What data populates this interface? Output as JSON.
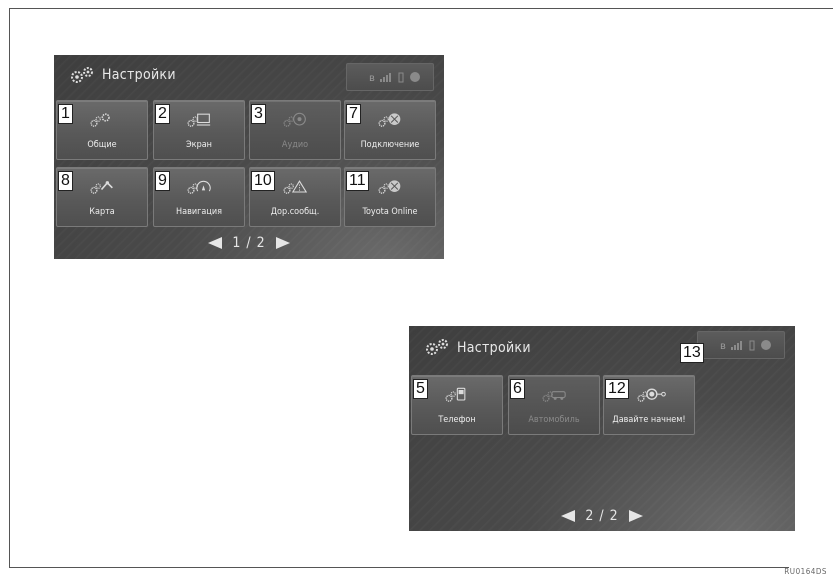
{
  "screen1": {
    "title": "Настройки",
    "buttons": [
      {
        "num": "1",
        "label": "Общие",
        "icon": "gears-icon",
        "enabled": true
      },
      {
        "num": "2",
        "label": "Экран",
        "icon": "display-icon",
        "enabled": true
      },
      {
        "num": "3",
        "label": "Аудио",
        "icon": "audio-icon",
        "enabled": false
      },
      {
        "num": "7",
        "label": "Подключение",
        "icon": "connection-icon",
        "enabled": true
      },
      {
        "num": "8",
        "label": "Карта",
        "icon": "map-icon",
        "enabled": true
      },
      {
        "num": "9",
        "label": "Навигация",
        "icon": "navigation-icon",
        "enabled": true
      },
      {
        "num": "10",
        "label": "Дор.сообщ.",
        "icon": "traffic-icon",
        "enabled": true
      },
      {
        "num": "11",
        "label": "Toyota Online",
        "icon": "online-icon",
        "enabled": true
      }
    ],
    "pager": "1 / 2"
  },
  "screen2": {
    "title": "Настройки",
    "status_num": "13",
    "buttons": [
      {
        "num": "5",
        "label": "Телефон",
        "icon": "phone-icon",
        "enabled": true
      },
      {
        "num": "6",
        "label": "Автомобиль",
        "icon": "vehicle-icon",
        "enabled": false
      },
      {
        "num": "12",
        "label": "Давайте начнем!",
        "icon": "get-started-icon",
        "enabled": true
      }
    ],
    "pager": "2 / 2"
  },
  "image_code": "RU0164DS"
}
